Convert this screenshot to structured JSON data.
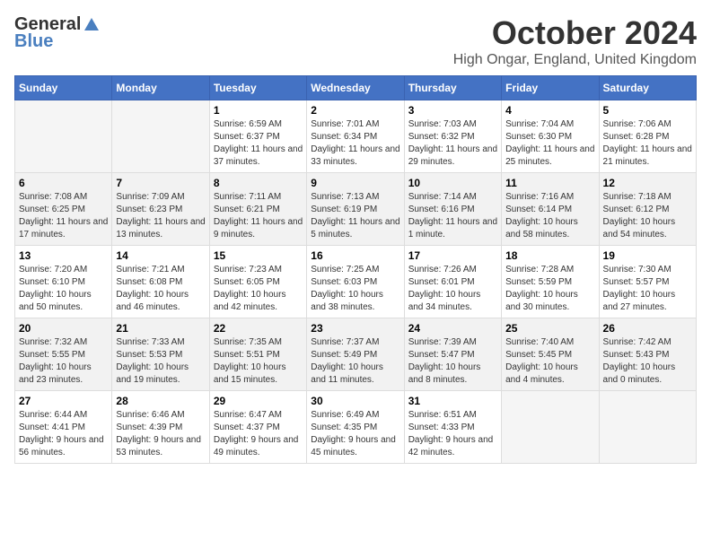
{
  "logo": {
    "general": "General",
    "blue": "Blue"
  },
  "title": "October 2024",
  "location": "High Ongar, England, United Kingdom",
  "days_of_week": [
    "Sunday",
    "Monday",
    "Tuesday",
    "Wednesday",
    "Thursday",
    "Friday",
    "Saturday"
  ],
  "weeks": [
    [
      {
        "day": "",
        "info": ""
      },
      {
        "day": "",
        "info": ""
      },
      {
        "day": "1",
        "info": "Sunrise: 6:59 AM\nSunset: 6:37 PM\nDaylight: 11 hours and 37 minutes."
      },
      {
        "day": "2",
        "info": "Sunrise: 7:01 AM\nSunset: 6:34 PM\nDaylight: 11 hours and 33 minutes."
      },
      {
        "day": "3",
        "info": "Sunrise: 7:03 AM\nSunset: 6:32 PM\nDaylight: 11 hours and 29 minutes."
      },
      {
        "day": "4",
        "info": "Sunrise: 7:04 AM\nSunset: 6:30 PM\nDaylight: 11 hours and 25 minutes."
      },
      {
        "day": "5",
        "info": "Sunrise: 7:06 AM\nSunset: 6:28 PM\nDaylight: 11 hours and 21 minutes."
      }
    ],
    [
      {
        "day": "6",
        "info": "Sunrise: 7:08 AM\nSunset: 6:25 PM\nDaylight: 11 hours and 17 minutes."
      },
      {
        "day": "7",
        "info": "Sunrise: 7:09 AM\nSunset: 6:23 PM\nDaylight: 11 hours and 13 minutes."
      },
      {
        "day": "8",
        "info": "Sunrise: 7:11 AM\nSunset: 6:21 PM\nDaylight: 11 hours and 9 minutes."
      },
      {
        "day": "9",
        "info": "Sunrise: 7:13 AM\nSunset: 6:19 PM\nDaylight: 11 hours and 5 minutes."
      },
      {
        "day": "10",
        "info": "Sunrise: 7:14 AM\nSunset: 6:16 PM\nDaylight: 11 hours and 1 minute."
      },
      {
        "day": "11",
        "info": "Sunrise: 7:16 AM\nSunset: 6:14 PM\nDaylight: 10 hours and 58 minutes."
      },
      {
        "day": "12",
        "info": "Sunrise: 7:18 AM\nSunset: 6:12 PM\nDaylight: 10 hours and 54 minutes."
      }
    ],
    [
      {
        "day": "13",
        "info": "Sunrise: 7:20 AM\nSunset: 6:10 PM\nDaylight: 10 hours and 50 minutes."
      },
      {
        "day": "14",
        "info": "Sunrise: 7:21 AM\nSunset: 6:08 PM\nDaylight: 10 hours and 46 minutes."
      },
      {
        "day": "15",
        "info": "Sunrise: 7:23 AM\nSunset: 6:05 PM\nDaylight: 10 hours and 42 minutes."
      },
      {
        "day": "16",
        "info": "Sunrise: 7:25 AM\nSunset: 6:03 PM\nDaylight: 10 hours and 38 minutes."
      },
      {
        "day": "17",
        "info": "Sunrise: 7:26 AM\nSunset: 6:01 PM\nDaylight: 10 hours and 34 minutes."
      },
      {
        "day": "18",
        "info": "Sunrise: 7:28 AM\nSunset: 5:59 PM\nDaylight: 10 hours and 30 minutes."
      },
      {
        "day": "19",
        "info": "Sunrise: 7:30 AM\nSunset: 5:57 PM\nDaylight: 10 hours and 27 minutes."
      }
    ],
    [
      {
        "day": "20",
        "info": "Sunrise: 7:32 AM\nSunset: 5:55 PM\nDaylight: 10 hours and 23 minutes."
      },
      {
        "day": "21",
        "info": "Sunrise: 7:33 AM\nSunset: 5:53 PM\nDaylight: 10 hours and 19 minutes."
      },
      {
        "day": "22",
        "info": "Sunrise: 7:35 AM\nSunset: 5:51 PM\nDaylight: 10 hours and 15 minutes."
      },
      {
        "day": "23",
        "info": "Sunrise: 7:37 AM\nSunset: 5:49 PM\nDaylight: 10 hours and 11 minutes."
      },
      {
        "day": "24",
        "info": "Sunrise: 7:39 AM\nSunset: 5:47 PM\nDaylight: 10 hours and 8 minutes."
      },
      {
        "day": "25",
        "info": "Sunrise: 7:40 AM\nSunset: 5:45 PM\nDaylight: 10 hours and 4 minutes."
      },
      {
        "day": "26",
        "info": "Sunrise: 7:42 AM\nSunset: 5:43 PM\nDaylight: 10 hours and 0 minutes."
      }
    ],
    [
      {
        "day": "27",
        "info": "Sunrise: 6:44 AM\nSunset: 4:41 PM\nDaylight: 9 hours and 56 minutes."
      },
      {
        "day": "28",
        "info": "Sunrise: 6:46 AM\nSunset: 4:39 PM\nDaylight: 9 hours and 53 minutes."
      },
      {
        "day": "29",
        "info": "Sunrise: 6:47 AM\nSunset: 4:37 PM\nDaylight: 9 hours and 49 minutes."
      },
      {
        "day": "30",
        "info": "Sunrise: 6:49 AM\nSunset: 4:35 PM\nDaylight: 9 hours and 45 minutes."
      },
      {
        "day": "31",
        "info": "Sunrise: 6:51 AM\nSunset: 4:33 PM\nDaylight: 9 hours and 42 minutes."
      },
      {
        "day": "",
        "info": ""
      },
      {
        "day": "",
        "info": ""
      }
    ]
  ]
}
